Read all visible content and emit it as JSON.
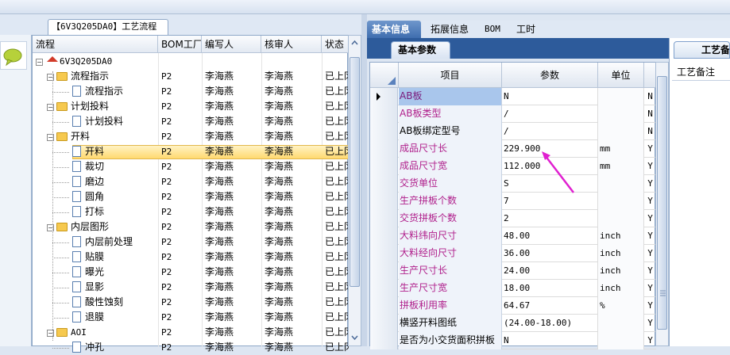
{
  "left_panel": {
    "tab_title": "【6V3Q205DA0】工艺流程",
    "columns": [
      "流程",
      "BOM工厂",
      "编写人",
      "核审人",
      "状态"
    ],
    "rows": [
      {
        "name": "6V3Q205DA0",
        "level": 0,
        "icon": "home-icon",
        "bom": "",
        "writer": "",
        "reviewer": "",
        "status": ""
      },
      {
        "name": "流程指示",
        "level": 1,
        "icon": "folder-icon",
        "bom": "P2",
        "writer": "李海燕",
        "reviewer": "李海燕",
        "status": "已上冈"
      },
      {
        "name": "流程指示",
        "level": 2,
        "icon": "document-icon",
        "bom": "P2",
        "writer": "李海燕",
        "reviewer": "李海燕",
        "status": "已上冈"
      },
      {
        "name": "计划投料",
        "level": 1,
        "icon": "folder-icon",
        "bom": "P2",
        "writer": "李海燕",
        "reviewer": "李海燕",
        "status": "已上冈"
      },
      {
        "name": "计划投料",
        "level": 2,
        "icon": "document-icon",
        "bom": "P2",
        "writer": "李海燕",
        "reviewer": "李海燕",
        "status": "已上冈"
      },
      {
        "name": "开料",
        "level": 1,
        "icon": "folder-icon",
        "bom": "P2",
        "writer": "李海燕",
        "reviewer": "李海燕",
        "status": "已上冈"
      },
      {
        "name": "开料",
        "level": 2,
        "icon": "document-icon",
        "bom": "P2",
        "writer": "李海燕",
        "reviewer": "李海燕",
        "status": "已上冈",
        "selected": true
      },
      {
        "name": "裁切",
        "level": 2,
        "icon": "document-icon",
        "bom": "P2",
        "writer": "李海燕",
        "reviewer": "李海燕",
        "status": "已上冈"
      },
      {
        "name": "磨边",
        "level": 2,
        "icon": "document-icon",
        "bom": "P2",
        "writer": "李海燕",
        "reviewer": "李海燕",
        "status": "已上冈"
      },
      {
        "name": "圆角",
        "level": 2,
        "icon": "document-icon",
        "bom": "P2",
        "writer": "李海燕",
        "reviewer": "李海燕",
        "status": "已上冈"
      },
      {
        "name": "打标",
        "level": 2,
        "icon": "document-icon",
        "bom": "P2",
        "writer": "李海燕",
        "reviewer": "李海燕",
        "status": "已上冈"
      },
      {
        "name": "内层图形",
        "level": 1,
        "icon": "folder-icon",
        "bom": "P2",
        "writer": "李海燕",
        "reviewer": "李海燕",
        "status": "已上冈"
      },
      {
        "name": "内层前处理",
        "level": 2,
        "icon": "document-icon",
        "bom": "P2",
        "writer": "李海燕",
        "reviewer": "李海燕",
        "status": "已上冈"
      },
      {
        "name": "贴膜",
        "level": 2,
        "icon": "document-icon",
        "bom": "P2",
        "writer": "李海燕",
        "reviewer": "李海燕",
        "status": "已上冈"
      },
      {
        "name": "曝光",
        "level": 2,
        "icon": "document-icon",
        "bom": "P2",
        "writer": "李海燕",
        "reviewer": "李海燕",
        "status": "已上冈"
      },
      {
        "name": "显影",
        "level": 2,
        "icon": "document-icon",
        "bom": "P2",
        "writer": "李海燕",
        "reviewer": "李海燕",
        "status": "已上冈"
      },
      {
        "name": "酸性蚀刻",
        "level": 2,
        "icon": "document-icon",
        "bom": "P2",
        "writer": "李海燕",
        "reviewer": "李海燕",
        "status": "已上冈"
      },
      {
        "name": "退膜",
        "level": 2,
        "icon": "document-icon",
        "bom": "P2",
        "writer": "李海燕",
        "reviewer": "李海燕",
        "status": "已上冈"
      },
      {
        "name": "AOI",
        "level": 1,
        "icon": "folder-icon",
        "bom": "P2",
        "writer": "李海燕",
        "reviewer": "李海燕",
        "status": "已上冈"
      },
      {
        "name": "冲孔",
        "level": 2,
        "icon": "document-icon",
        "bom": "P2",
        "writer": "李海燕",
        "reviewer": "李海燕",
        "status": "已上冈"
      }
    ]
  },
  "right_tabs": [
    "基本信息",
    "拓展信息",
    "BOM",
    "工时"
  ],
  "sub_tab": "基本参数",
  "right_side": {
    "tab": "工艺备",
    "note_label": "工艺备注"
  },
  "param_grid": {
    "columns": [
      "项目",
      "参数",
      "单位"
    ],
    "rows": [
      {
        "name": "AB板",
        "value": "N",
        "unit": "",
        "flag": "N",
        "required": true,
        "selected": true
      },
      {
        "name": "AB板类型",
        "value": "/",
        "unit": "",
        "flag": "N",
        "required": true
      },
      {
        "name": "AB板绑定型号",
        "value": "/",
        "unit": "",
        "flag": "N",
        "required": false
      },
      {
        "name": "成品尺寸长",
        "value": "229.900",
        "unit": "mm",
        "flag": "Y",
        "required": true
      },
      {
        "name": "成品尺寸宽",
        "value": "112.000",
        "unit": "mm",
        "flag": "Y",
        "required": true
      },
      {
        "name": "交货单位",
        "value": "S",
        "unit": "",
        "flag": "Y",
        "required": true
      },
      {
        "name": "生产拼板个数",
        "value": "7",
        "unit": "",
        "flag": "Y",
        "required": true
      },
      {
        "name": "交货拼板个数",
        "value": "2",
        "unit": "",
        "flag": "Y",
        "required": true
      },
      {
        "name": "大料纬向尺寸",
        "value": "48.00",
        "unit": "inch",
        "flag": "Y",
        "required": true
      },
      {
        "name": "大料经向尺寸",
        "value": "36.00",
        "unit": "inch",
        "flag": "Y",
        "required": true
      },
      {
        "name": "生产尺寸长",
        "value": "24.00",
        "unit": "inch",
        "flag": "Y",
        "required": true
      },
      {
        "name": "生产尺寸宽",
        "value": "18.00",
        "unit": "inch",
        "flag": "Y",
        "required": true
      },
      {
        "name": "拼板利用率",
        "value": "64.67",
        "unit": "%",
        "flag": "Y",
        "required": true
      },
      {
        "name": "横竖开料图纸",
        "value": "(24.00-18.00)",
        "unit": "",
        "flag": "Y",
        "required": false
      },
      {
        "name": "是否为小交货面积拼板",
        "value": "N",
        "unit": "",
        "flag": "Y",
        "required": false
      }
    ]
  },
  "colors": {
    "accent": "#3f6eaf",
    "required_text": "#b0208c",
    "annotation_arrow": "#e020d0",
    "selection": "#ffd970"
  }
}
